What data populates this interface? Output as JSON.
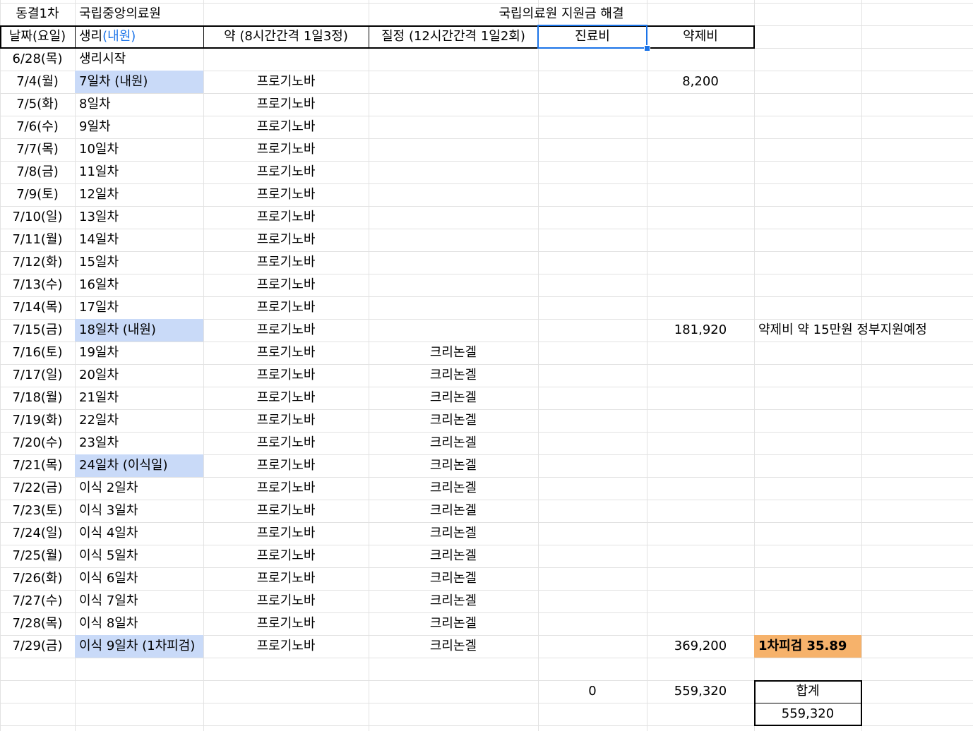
{
  "title_row": {
    "col_a": "동결1차",
    "col_b": "국립중앙의료원",
    "col_cd_title": "국립의료원 지원금 해결"
  },
  "header": {
    "date": "날짜(요일)",
    "period_prefix": "생리",
    "period_suffix": "(내원)",
    "medicine": "약 (8시간간격 1일3정)",
    "vaginal": "질정 (12시간간격 1일2회)",
    "treatment_fee": "진료비",
    "drug_fee": "약제비"
  },
  "rows": [
    {
      "date": "6/28(목)",
      "day": "생리시작",
      "highlight": false,
      "med": "",
      "vag": "",
      "treat": "",
      "drug": "",
      "note": ""
    },
    {
      "date": "7/4(월)",
      "day": "7일차 (내원)",
      "highlight": true,
      "med": "프로기노바",
      "vag": "",
      "treat": "",
      "drug": "8,200",
      "note": ""
    },
    {
      "date": "7/5(화)",
      "day": "8일차",
      "highlight": false,
      "med": "프로기노바",
      "vag": "",
      "treat": "",
      "drug": "",
      "note": ""
    },
    {
      "date": "7/6(수)",
      "day": "9일차",
      "highlight": false,
      "med": "프로기노바",
      "vag": "",
      "treat": "",
      "drug": "",
      "note": ""
    },
    {
      "date": "7/7(목)",
      "day": "10일차",
      "highlight": false,
      "med": "프로기노바",
      "vag": "",
      "treat": "",
      "drug": "",
      "note": ""
    },
    {
      "date": "7/8(금)",
      "day": "11일차",
      "highlight": false,
      "med": "프로기노바",
      "vag": "",
      "treat": "",
      "drug": "",
      "note": ""
    },
    {
      "date": "7/9(토)",
      "day": "12일차",
      "highlight": false,
      "med": "프로기노바",
      "vag": "",
      "treat": "",
      "drug": "",
      "note": ""
    },
    {
      "date": "7/10(일)",
      "day": "13일차",
      "highlight": false,
      "med": "프로기노바",
      "vag": "",
      "treat": "",
      "drug": "",
      "note": ""
    },
    {
      "date": "7/11(월)",
      "day": "14일차",
      "highlight": false,
      "med": "프로기노바",
      "vag": "",
      "treat": "",
      "drug": "",
      "note": ""
    },
    {
      "date": "7/12(화)",
      "day": "15일차",
      "highlight": false,
      "med": "프로기노바",
      "vag": "",
      "treat": "",
      "drug": "",
      "note": ""
    },
    {
      "date": "7/13(수)",
      "day": "16일차",
      "highlight": false,
      "med": "프로기노바",
      "vag": "",
      "treat": "",
      "drug": "",
      "note": ""
    },
    {
      "date": "7/14(목)",
      "day": "17일차",
      "highlight": false,
      "med": "프로기노바",
      "vag": "",
      "treat": "",
      "drug": "",
      "note": ""
    },
    {
      "date": "7/15(금)",
      "day": "18일차 (내원)",
      "highlight": true,
      "med": "프로기노바",
      "vag": "",
      "treat": "",
      "drug": "181,920",
      "note": "약제비 약 15만원 정부지원예정"
    },
    {
      "date": "7/16(토)",
      "day": "19일차",
      "highlight": false,
      "med": "프로기노바",
      "vag": "크리논겔",
      "treat": "",
      "drug": "",
      "note": ""
    },
    {
      "date": "7/17(일)",
      "day": "20일차",
      "highlight": false,
      "med": "프로기노바",
      "vag": "크리논겔",
      "treat": "",
      "drug": "",
      "note": ""
    },
    {
      "date": "7/18(월)",
      "day": "21일차",
      "highlight": false,
      "med": "프로기노바",
      "vag": "크리논겔",
      "treat": "",
      "drug": "",
      "note": ""
    },
    {
      "date": "7/19(화)",
      "day": "22일차",
      "highlight": false,
      "med": "프로기노바",
      "vag": "크리논겔",
      "treat": "",
      "drug": "",
      "note": ""
    },
    {
      "date": "7/20(수)",
      "day": "23일차",
      "highlight": false,
      "med": "프로기노바",
      "vag": "크리논겔",
      "treat": "",
      "drug": "",
      "note": ""
    },
    {
      "date": "7/21(목)",
      "day": "24일차 (이식일)",
      "highlight": true,
      "med": "프로기노바",
      "vag": "크리논겔",
      "treat": "",
      "drug": "",
      "note": ""
    },
    {
      "date": "7/22(금)",
      "day": "이식 2일차",
      "highlight": false,
      "med": "프로기노바",
      "vag": "크리논겔",
      "treat": "",
      "drug": "",
      "note": ""
    },
    {
      "date": "7/23(토)",
      "day": "이식 3일차",
      "highlight": false,
      "med": "프로기노바",
      "vag": "크리논겔",
      "treat": "",
      "drug": "",
      "note": ""
    },
    {
      "date": "7/24(일)",
      "day": "이식 4일차",
      "highlight": false,
      "med": "프로기노바",
      "vag": "크리논겔",
      "treat": "",
      "drug": "",
      "note": ""
    },
    {
      "date": "7/25(월)",
      "day": "이식 5일차",
      "highlight": false,
      "med": "프로기노바",
      "vag": "크리논겔",
      "treat": "",
      "drug": "",
      "note": ""
    },
    {
      "date": "7/26(화)",
      "day": "이식 6일차",
      "highlight": false,
      "med": "프로기노바",
      "vag": "크리논겔",
      "treat": "",
      "drug": "",
      "note": ""
    },
    {
      "date": "7/27(수)",
      "day": "이식 7일차",
      "highlight": false,
      "med": "프로기노바",
      "vag": "크리논겔",
      "treat": "",
      "drug": "",
      "note": ""
    },
    {
      "date": "7/28(목)",
      "day": "이식 8일차",
      "highlight": false,
      "med": "프로기노바",
      "vag": "크리논겔",
      "treat": "",
      "drug": "",
      "note": ""
    },
    {
      "date": "7/29(금)",
      "day": "이식 9일차 (1차피검)",
      "highlight": true,
      "med": "프로기노바",
      "vag": "크리논겔",
      "treat": "",
      "drug": "369,200",
      "note": "1차피검 35.89"
    }
  ],
  "totals": {
    "treatment_total": "0",
    "drug_total": "559,320",
    "sum_label": "합계",
    "sum_value": "559,320"
  },
  "colors": {
    "highlight": "#c9daf8",
    "note_orange": "#f6b26b",
    "selection": "#1a73e8",
    "gridline": "#e2e2e2"
  }
}
